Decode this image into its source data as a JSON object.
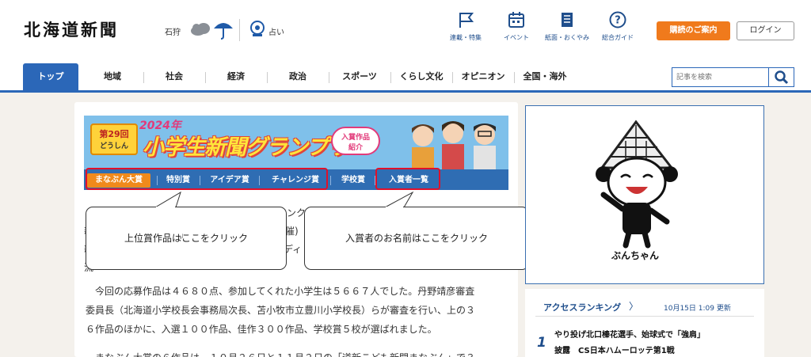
{
  "header": {
    "logo": "北海道新聞",
    "region": "石狩",
    "fortune_label": "占い",
    "nav_icons": [
      {
        "label": "連載・特集",
        "icon": "flag-icon"
      },
      {
        "label": "イベント",
        "icon": "calendar-icon"
      },
      {
        "label": "紙面・おくやみ",
        "icon": "newspaper-icon"
      },
      {
        "label": "総合ガイド",
        "icon": "help-icon"
      }
    ],
    "subscribe_label": "購読のご案内",
    "login_label": "ログイン"
  },
  "categories": [
    "トップ",
    "地域",
    "社会",
    "経済",
    "政治",
    "スポーツ",
    "くらし文化",
    "オピニオン",
    "全国・海外"
  ],
  "search": {
    "placeholder": "記事を検索"
  },
  "banner": {
    "badge_line1": "第29回",
    "badge_line2": "どうしん",
    "year": "2024年",
    "title": "小学生新聞グランプリ",
    "bubble_line1": "入賞作品",
    "bubble_line2": "紹介",
    "tabs": [
      "まなぶん大賞",
      "特別賞",
      "アイデア賞",
      "チャレンジ賞",
      "学校賞",
      "入賞者一覧"
    ]
  },
  "article": {
    "partial_top": "ロンク",
    "partial_left1": "新",
    "partial_left2": "新",
    "partial_left3": "流",
    "partial_mid1": "主催)",
    "partial_mid2": "ディ",
    "paragraph1": [
      "　今回の応募作品は４６８０点、参加してくれた小学生は５６６７人でした。丹野靖彦審査",
      "委員長（北海道小学校長会事務局次長、苫小牧市立豊川小学校長）らが審査を行い、上の３",
      "６作品のほかに、入選１００作品、佳作３００作品、学校賞５校が選ばれました。"
    ],
    "paragraph2_partial": "　まなぶん大賞の６作品は、１０月２６日と１１月２日の「道新こども新聞まなぶん」で３"
  },
  "callouts": {
    "left": "上位賞作品はここをクリック",
    "right": "入賞者のお名前はここをクリック",
    "return_mark": "↲"
  },
  "sidebar": {
    "mascot_name": "ぶんちゃん",
    "ranking_title": "アクセスランキング",
    "ranking_chevron": "〉",
    "ranking_updated": "10月15日 1:09 更新",
    "rank1_number": "1",
    "rank1_line1": "やり投げ北口榛花選手、始球式で「強肩」",
    "rank1_line2": "披露　CS日本ハムーロッテ第1戦"
  },
  "colors": {
    "accent": "#2b67b8",
    "orange": "#f07a1c",
    "highlight": "#e0102a"
  }
}
